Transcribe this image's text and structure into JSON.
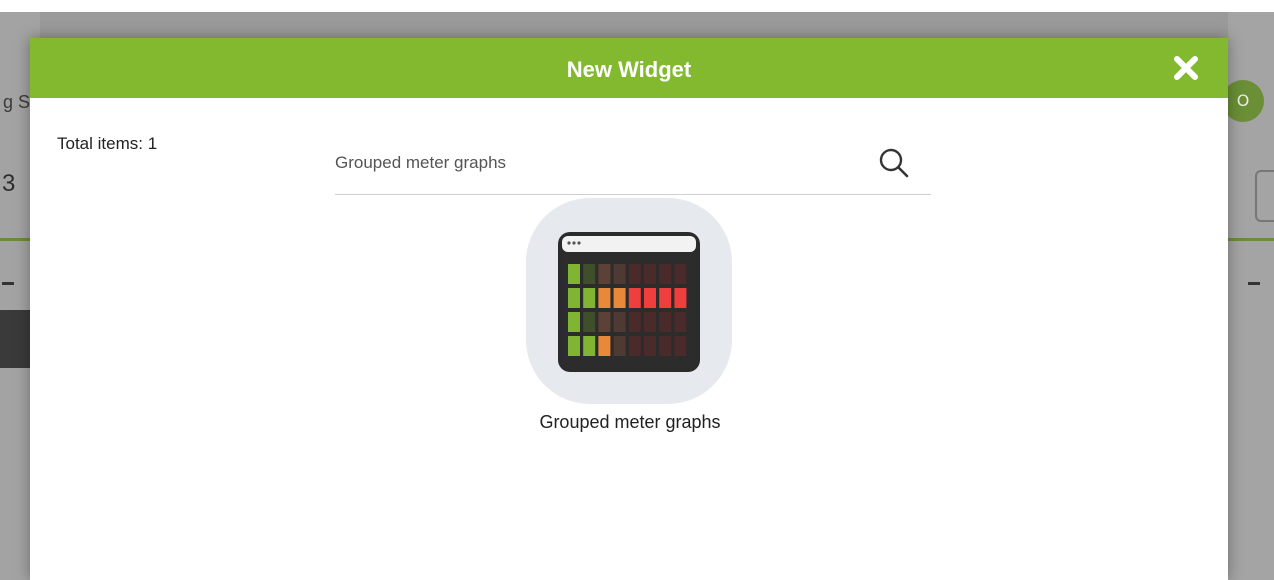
{
  "background": {
    "left_text": "g S",
    "left_number": "3",
    "avatar_initial": "O"
  },
  "modal": {
    "title": "New Widget",
    "close_icon": "close-icon",
    "header_color": "#82b92e",
    "total_items_label": "Total items: 1",
    "search": {
      "value": "",
      "placeholder": "Grouped meter graphs",
      "icon": "search-icon"
    },
    "widgets": [
      {
        "label": "Grouped meter graphs",
        "icon": "grouped-meter-graphs-icon"
      }
    ]
  }
}
